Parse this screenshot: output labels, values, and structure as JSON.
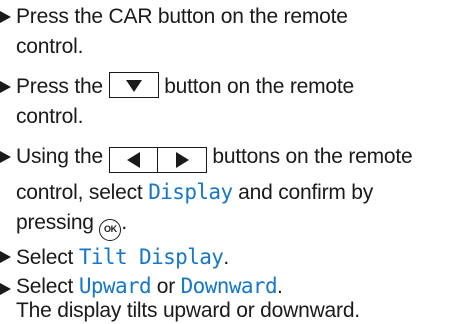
{
  "steps": [
    {
      "lines": [
        "Press the CAR button on the remote",
        "control."
      ]
    },
    {
      "before": "Press the",
      "button_icon": "down-arrow-icon",
      "after": "button on the remote",
      "line2": "control."
    },
    {
      "before": "Using the",
      "button_icons": [
        "left-arrow-icon",
        "right-arrow-icon"
      ],
      "after": "buttons on the remote",
      "line2_before": "control, select",
      "line2_highlight": "Display",
      "line2_after": "and confirm by",
      "line3_before": "pressing",
      "ok_label": "OK",
      "line3_after": "."
    },
    {
      "before": "Select",
      "highlight": "Tilt Display",
      "after": "."
    },
    {
      "before": "Select",
      "highlight1": "Upward",
      "middle": "or",
      "highlight2": "Downward",
      "after": ".",
      "result": "The display tilts upward or downward."
    }
  ],
  "colors": {
    "text": "#1a1a1a",
    "highlight": "#1578c8"
  }
}
